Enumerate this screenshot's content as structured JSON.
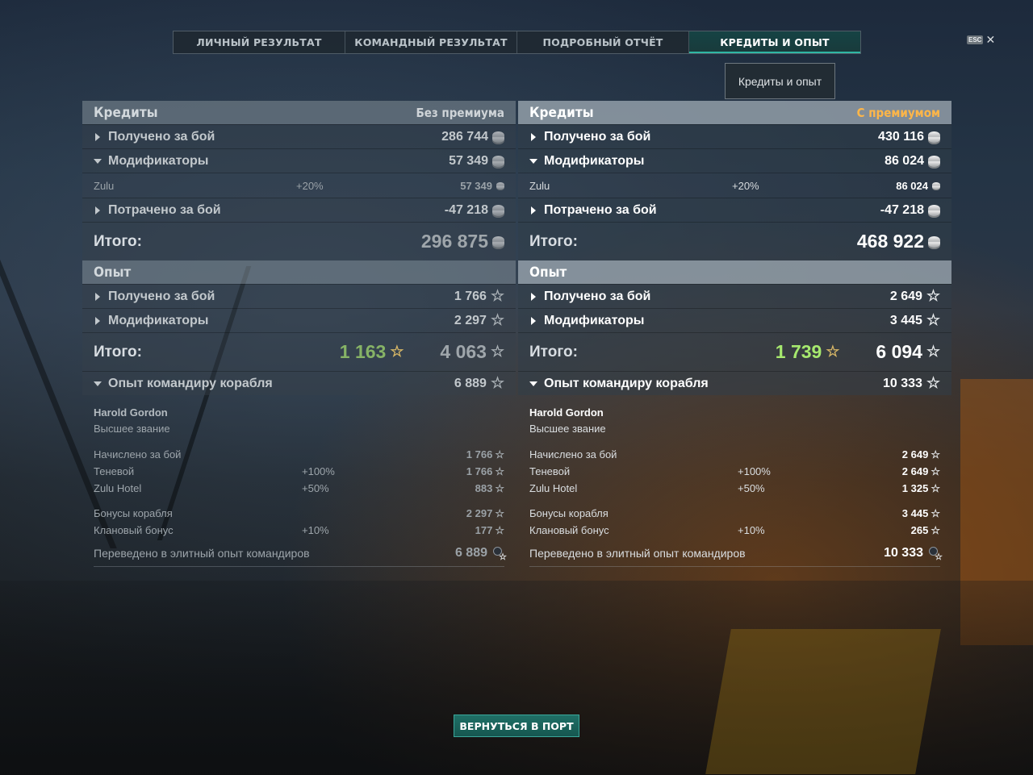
{
  "tabs": [
    "ЛИЧНЫЙ РЕЗУЛЬТАТ",
    "КОМАНДНЫЙ РЕЗУЛЬТАТ",
    "ПОДРОБНЫЙ ОТЧЁТ",
    "КРЕДИТЫ И ОПЫТ"
  ],
  "active_tab": "КРЕДИТЫ И ОПЫТ",
  "esc_label": "ESC",
  "close_symbol": "✕",
  "tooltip": "Кредиты и опыт",
  "left": {
    "credits_title": "Кредиты",
    "premium_label": "Без премиума",
    "credits_rows": [
      {
        "label": "Получено за бой",
        "value": "286 744"
      },
      {
        "label": "Модификаторы",
        "value": "57 349"
      },
      {
        "label": "Zulu",
        "pct": "+20%",
        "value": "57 349"
      },
      {
        "label": "Потрачено за бой",
        "value": "-47 218"
      }
    ],
    "credits_total_label": "Итого:",
    "credits_total": "296 875",
    "xp_title": "Опыт",
    "xp_rows": [
      {
        "label": "Получено за бой",
        "value": "1 766"
      },
      {
        "label": "Модификаторы",
        "value": "2 297"
      }
    ],
    "xp_total_label": "Итого:",
    "xp_free": "1 163",
    "xp_total": "4 063",
    "commander_xp_label": "Опыт командиру корабля",
    "commander_xp": "6 889",
    "commander_name": "Harold Gordon",
    "commander_rank": "Высшее звание",
    "cmd_rows": [
      {
        "label": "Начислено за бой",
        "pct": "",
        "value": "1 766"
      },
      {
        "label": "Теневой",
        "pct": "+100%",
        "value": "1 766"
      },
      {
        "label": "Zulu Hotel",
        "pct": "+50%",
        "value": "883"
      },
      {
        "label": "Бонусы корабля",
        "pct": "",
        "value": "2 297"
      },
      {
        "label": "Клановый бонус",
        "pct": "+10%",
        "value": "177"
      }
    ],
    "transfer_label": "Переведено в элитный опыт командиров",
    "transfer_value": "6 889"
  },
  "right": {
    "credits_title": "Кредиты",
    "premium_label": "С премиумом",
    "credits_rows": [
      {
        "label": "Получено за бой",
        "value": "430 116"
      },
      {
        "label": "Модификаторы",
        "value": "86 024"
      },
      {
        "label": "Zulu",
        "pct": "+20%",
        "value": "86 024"
      },
      {
        "label": "Потрачено за бой",
        "value": "-47 218"
      }
    ],
    "credits_total_label": "Итого:",
    "credits_total": "468 922",
    "xp_title": "Опыт",
    "xp_rows": [
      {
        "label": "Получено за бой",
        "value": "2 649"
      },
      {
        "label": "Модификаторы",
        "value": "3 445"
      }
    ],
    "xp_total_label": "Итого:",
    "xp_free": "1 739",
    "xp_total": "6 094",
    "commander_xp_label": "Опыт командиру корабля",
    "commander_xp": "10 333",
    "commander_name": "Harold Gordon",
    "commander_rank": "Высшее звание",
    "cmd_rows": [
      {
        "label": "Начислено за бой",
        "pct": "",
        "value": "2 649"
      },
      {
        "label": "Теневой",
        "pct": "+100%",
        "value": "2 649"
      },
      {
        "label": "Zulu Hotel",
        "pct": "+50%",
        "value": "1 325"
      },
      {
        "label": "Бонусы корабля",
        "pct": "",
        "value": "3 445"
      },
      {
        "label": "Клановый бонус",
        "pct": "+10%",
        "value": "265"
      }
    ],
    "transfer_label": "Переведено в элитный опыт командиров",
    "transfer_value": "10 333"
  },
  "back_button": "ВЕРНУТЬСЯ В ПОРТ",
  "icons": {
    "credits": "coin-stack-icon",
    "xp": "star-icon",
    "elite": "commander-elite-icon"
  },
  "colors": {
    "premium": "#ffb648",
    "free_xp": "#a6e86e",
    "active_tab": "#2fb7a4",
    "button": "#1f6f66"
  }
}
